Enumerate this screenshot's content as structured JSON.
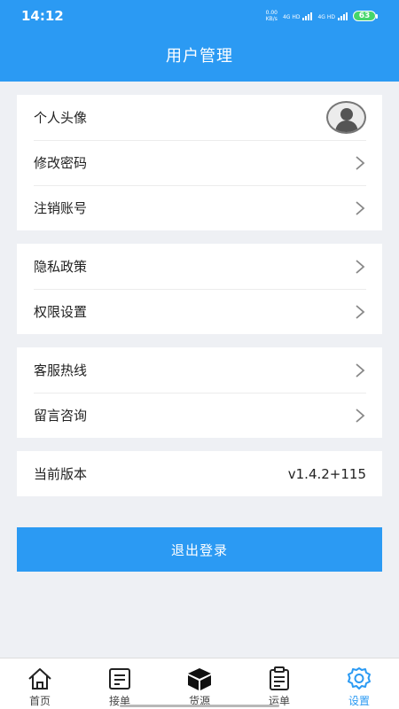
{
  "status": {
    "time": "14:12",
    "speed_value": "0.00",
    "speed_unit": "KB/s",
    "signal1": "4G HD",
    "signal2": "4G HD",
    "battery": "63"
  },
  "header": {
    "title": "用户管理"
  },
  "groups": {
    "account": {
      "avatar_label": "个人头像",
      "password_label": "修改密码",
      "deregister_label": "注销账号"
    },
    "policy": {
      "privacy_label": "隐私政策",
      "permissions_label": "权限设置"
    },
    "support": {
      "hotline_label": "客服热线",
      "message_label": "留言咨询"
    },
    "about": {
      "version_label": "当前版本",
      "version_value": "v1.4.2+115"
    }
  },
  "logout_label": "退出登录",
  "tabs": {
    "home": {
      "label": "首页",
      "icon": "home-icon"
    },
    "orders": {
      "label": "接单",
      "icon": "order-list-icon"
    },
    "cargo": {
      "label": "货源",
      "icon": "box-icon"
    },
    "waybill": {
      "label": "运单",
      "icon": "clipboard-icon"
    },
    "settings": {
      "label": "设置",
      "icon": "gear-icon"
    }
  },
  "colors": {
    "primary": "#2b9af3",
    "background": "#eef0f4"
  }
}
